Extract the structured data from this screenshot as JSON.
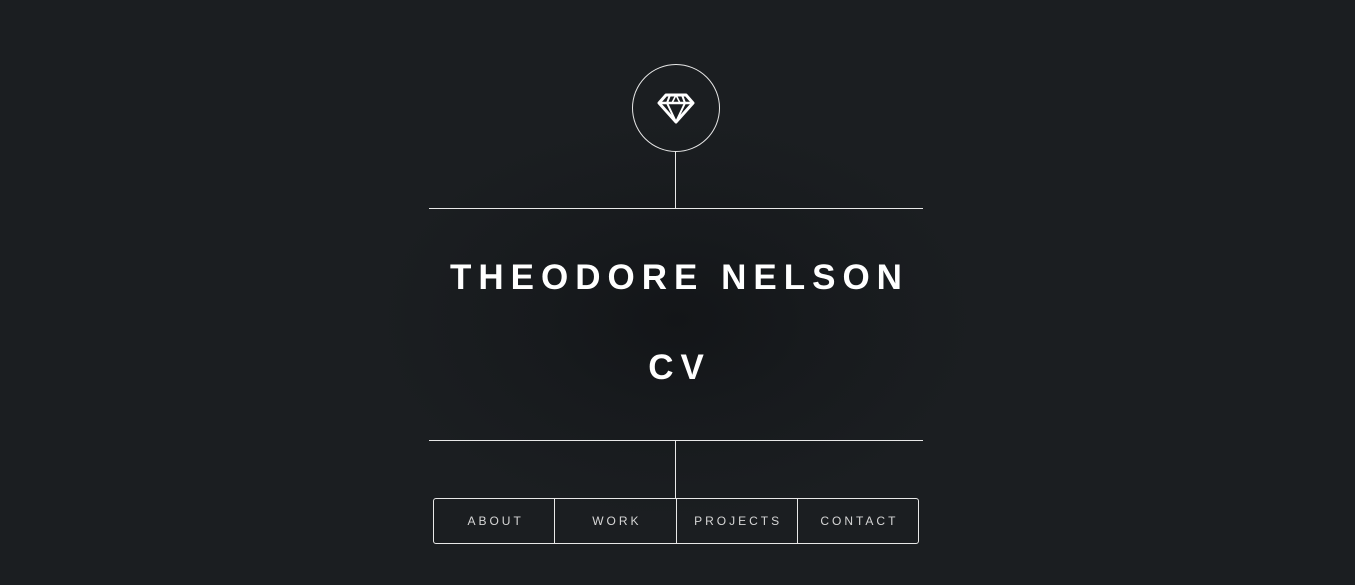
{
  "header": {
    "logo_icon": "diamond-icon",
    "name": "THEODORE NELSON",
    "subtitle": "CV"
  },
  "nav": {
    "items": [
      {
        "label": "ABOUT"
      },
      {
        "label": "WORK"
      },
      {
        "label": "PROJECTS"
      },
      {
        "label": "CONTACT"
      }
    ]
  },
  "colors": {
    "background": "#1b1e21",
    "foreground": "#ffffff",
    "line": "#e8e8e8"
  }
}
